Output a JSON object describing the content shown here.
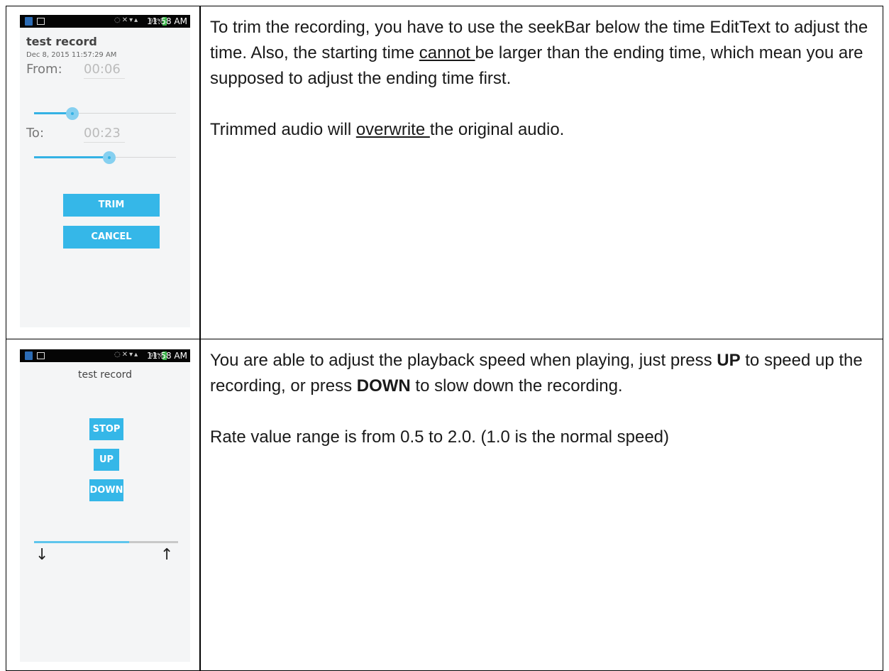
{
  "trim_row": {
    "phone": {
      "status_time": "11:58 AM",
      "battery": "98%",
      "title": "test record",
      "date": "Dec 8, 2015 11:57:29 AM",
      "from_label": "From:",
      "from_value": "00:06",
      "to_label": "To:",
      "to_value": "00:23",
      "from_position": 0.27,
      "to_position": 0.53,
      "trim_button": "TRIM",
      "cancel_button": "CANCEL"
    },
    "para1_a": "To trim the recording, you have to use the seekBar below the time EditText to adjust the time. Also, the starting time ",
    "para1_u": "cannot ",
    "para1_b": "be larger than the ending time, which mean you are supposed to adjust the ending time first.",
    "para2_a": "Trimmed audio will ",
    "para2_u": "overwrite ",
    "para2_b": "the original audio."
  },
  "speed_row": {
    "phone": {
      "status_time": "11:58 AM",
      "battery": "98%",
      "title": "test record",
      "stop_button": "STOP",
      "up_button": "UP",
      "down_button": "DOWN",
      "rate_position": 0.66,
      "down_arrow": "↓",
      "up_arrow": "↑"
    },
    "para1_a": "You are able to adjust the playback speed when playing, just press ",
    "para1_b1": "UP",
    "para1_c": " to speed up the recording, or press ",
    "para1_b2": "DOWN",
    "para1_d": " to slow down the recording.",
    "para2": "Rate value range is from 0.5 to 2.0. (1.0 is the normal speed)"
  }
}
